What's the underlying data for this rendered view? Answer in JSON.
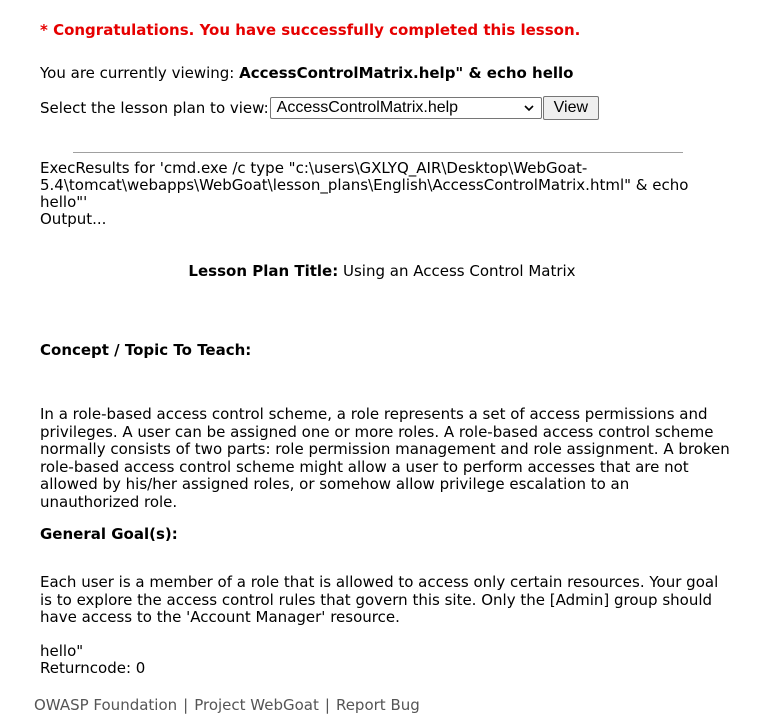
{
  "congrats": "* Congratulations. You have successfully completed this lesson.",
  "viewing": {
    "prefix": "You are currently viewing: ",
    "value": "AccessControlMatrix.help\" & echo hello"
  },
  "lesson_select": {
    "label": "Select the lesson plan to view:",
    "selected": "AccessControlMatrix.help",
    "button": "View"
  },
  "exec": {
    "line1": "ExecResults for 'cmd.exe /c type \"c:\\users\\GXLYQ_AIR\\Desktop\\WebGoat-5.4\\tomcat\\webapps\\WebGoat\\lesson_plans\\English\\AccessControlMatrix.html\" & echo hello\"'",
    "line2": "Output..."
  },
  "lesson_plan": {
    "title_label": "Lesson Plan Title:",
    "title_value": " Using an Access Control Matrix"
  },
  "concept": {
    "heading": "Concept / Topic To Teach:",
    "text": "In a role-based access control scheme, a role represents a set of access permissions and privileges. A user can be assigned one or more roles. A role-based access control scheme normally consists of two parts: role permission management and role assignment. A broken role-based access control scheme might allow a user to perform accesses that are not allowed by his/her assigned roles, or somehow allow privilege escalation to an unauthorized role."
  },
  "goal": {
    "heading": "General Goal(s):",
    "text": "Each user is a member of a role that is allowed to access only certain resources. Your goal is to explore the access control rules that govern this site. Only the [Admin] group should have access to the 'Account Manager' resource."
  },
  "output_end": {
    "line1": "hello\"",
    "line2": "Returncode: 0"
  },
  "footer": {
    "links": [
      "OWASP Foundation",
      "Project WebGoat",
      "Report Bug"
    ],
    "separator": "|"
  }
}
